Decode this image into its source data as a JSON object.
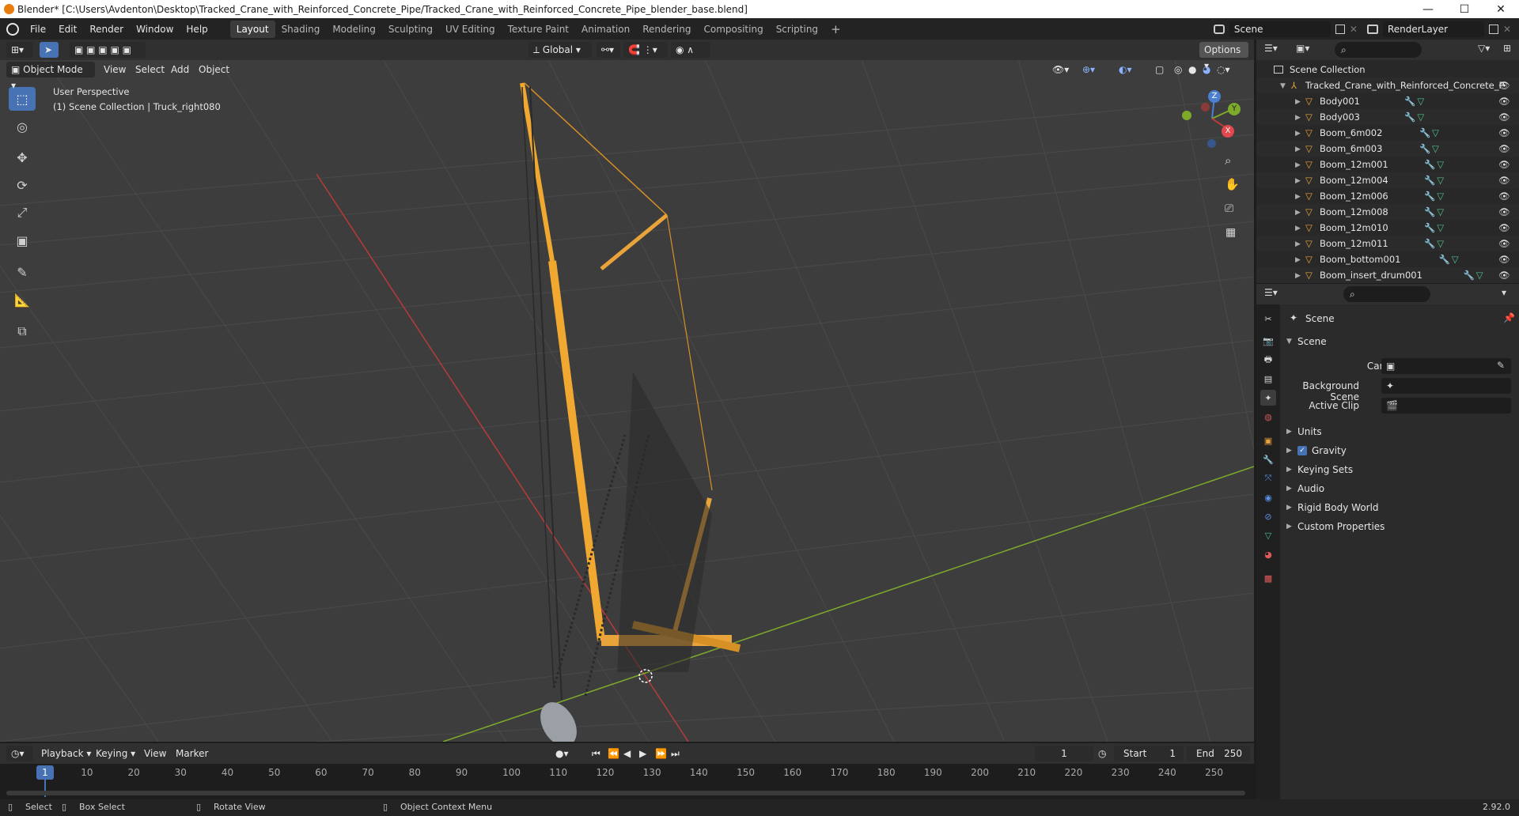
{
  "title_bar": {
    "title": "Blender* [C:\\Users\\Avdenton\\Desktop\\Tracked_Crane_with_Reinforced_Concrete_Pipe/Tracked_Crane_with_Reinforced_Concrete_Pipe_blender_base.blend]",
    "minimize": "—",
    "maximize": "☐",
    "close": "✕"
  },
  "menubar": {
    "menus": [
      "File",
      "Edit",
      "Render",
      "Window",
      "Help"
    ],
    "workspaces": [
      "Layout",
      "Shading",
      "Modeling",
      "Sculpting",
      "UV Editing",
      "Texture Paint",
      "Animation",
      "Rendering",
      "Compositing",
      "Scripting"
    ],
    "active_workspace": "Layout",
    "add_workspace": "+",
    "scene": "Scene",
    "render_layer": "RenderLayer"
  },
  "viewport_header": {
    "transform_orientation": "Global",
    "options": "Options",
    "mode": "Object Mode",
    "menus": [
      "View",
      "Select",
      "Add",
      "Object"
    ]
  },
  "viewport": {
    "perspective": "User Perspective",
    "collection_info": "(1) Scene Collection | Truck_right080",
    "gizmo": {
      "x": "X",
      "y": "Y",
      "z": "Z"
    }
  },
  "outliner": {
    "root": "Scene Collection",
    "collection": "Tracked_Crane_with_Reinforced_Concrete_P",
    "items": [
      "Body001",
      "Body003",
      "Boom_6m002",
      "Boom_6m003",
      "Boom_12m001",
      "Boom_12m004",
      "Boom_12m006",
      "Boom_12m008",
      "Boom_12m010",
      "Boom_12m011",
      "Boom_bottom001",
      "Boom_insert_drum001"
    ]
  },
  "properties": {
    "context": "Scene",
    "panel": "Scene",
    "camera_label": "Camera",
    "background_scene_label": "Background Scene",
    "active_clip_label": "Active Clip",
    "sections": [
      "Units",
      "Gravity",
      "Keying Sets",
      "Audio",
      "Rigid Body World",
      "Custom Properties"
    ],
    "gravity_checked": true
  },
  "timeline": {
    "menus": [
      "Playback",
      "Keying",
      "View",
      "Marker"
    ],
    "current_frame": "1",
    "start_label": "Start",
    "start": "1",
    "end_label": "End",
    "end": "250",
    "ticks": [
      "1",
      "10",
      "20",
      "30",
      "40",
      "50",
      "60",
      "70",
      "80",
      "90",
      "100",
      "110",
      "120",
      "130",
      "140",
      "150",
      "160",
      "170",
      "180",
      "190",
      "200",
      "210",
      "220",
      "230",
      "240",
      "250"
    ]
  },
  "statusbar": {
    "select": "Select",
    "box_select": "Box Select",
    "rotate_view": "Rotate View",
    "context_menu": "Object Context Menu",
    "version": "2.92.0"
  },
  "colors": {
    "accent": "#4772b3",
    "object_orange": "#e8a33b",
    "x_axis": "#b83b3b",
    "y_axis": "#7eaa2c",
    "z_axis": "#4b7fd1"
  }
}
